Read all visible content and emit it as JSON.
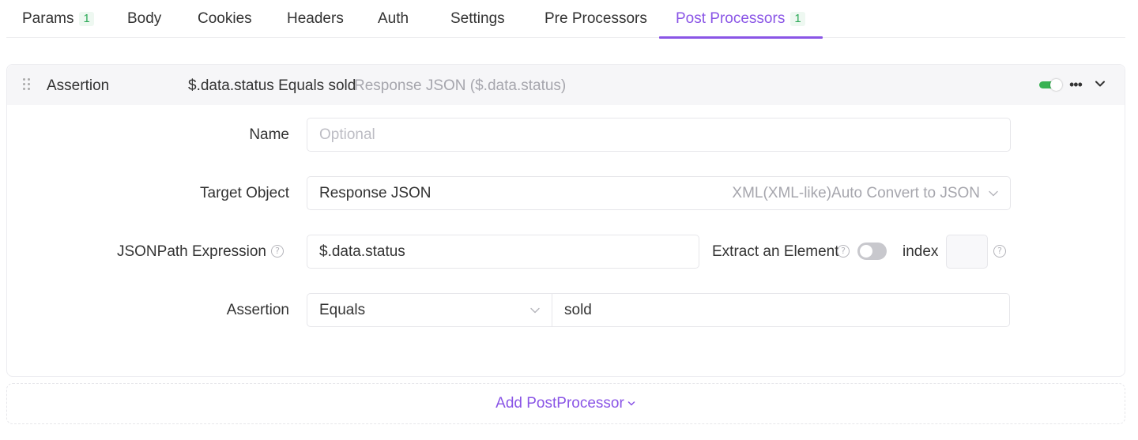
{
  "tabs": [
    {
      "label": "Params",
      "badge": "1"
    },
    {
      "label": "Body"
    },
    {
      "label": "Cookies"
    },
    {
      "label": "Headers"
    },
    {
      "label": "Auth"
    },
    {
      "label": "Settings"
    },
    {
      "label": "Pre Processors"
    },
    {
      "label": "Post Processors",
      "badge": "1",
      "active": true
    }
  ],
  "processor": {
    "type": "Assertion",
    "summary": "$.data.status Equals sold",
    "detail": "Response JSON ($.data.status)",
    "enabled": true,
    "more_icon": "more-horizontal-icon",
    "collapse_icon": "chevron-down-icon"
  },
  "form": {
    "name": {
      "label": "Name",
      "value": "",
      "placeholder": "Optional"
    },
    "target_object": {
      "label": "Target Object",
      "value": "Response JSON",
      "hint": "XML(XML-like)Auto Convert to JSON"
    },
    "jsonpath": {
      "label": "JSONPath Expression",
      "value": "$.data.status"
    },
    "extract": {
      "label": "Extract an Element",
      "enabled": false,
      "index_label": "index",
      "index_value": ""
    },
    "assertion": {
      "label": "Assertion",
      "operator": "Equals",
      "value": "sold"
    }
  },
  "add_button": {
    "label": "Add PostProcessor"
  },
  "colors": {
    "accent": "#8a55e6",
    "toggle_on": "#38b253",
    "badge": "#2eaa58"
  }
}
